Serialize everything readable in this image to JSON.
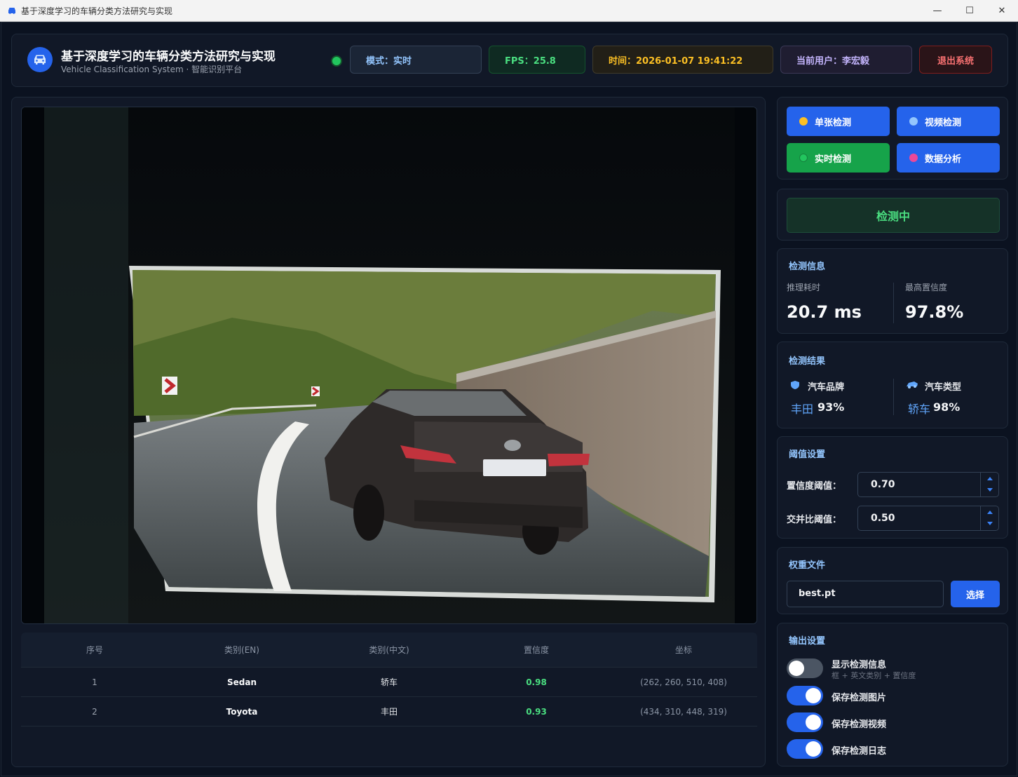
{
  "window": {
    "title": "基于深度学习的车辆分类方法研究与实现",
    "min_glyph": "—",
    "max_glyph": "☐",
    "close_glyph": "✕"
  },
  "header": {
    "title": "基于深度学习的车辆分类方法研究与实现",
    "subtitle": "Vehicle Classification System · 智能识别平台",
    "mode": "模式：实时",
    "fps": "FPS：25.8",
    "time": "时间：2026-01-07 19:41:22",
    "user": "当前用户：李宏毅",
    "exit_label": "退出系统"
  },
  "table": {
    "headers": [
      "序号",
      "类别(EN)",
      "类别(中文)",
      "置信度",
      "坐标"
    ],
    "rows": [
      [
        "1",
        "Sedan",
        "轿车",
        "0.98",
        "(262, 260, 510, 408)"
      ],
      [
        "2",
        "Toyota",
        "丰田",
        "0.93",
        "(434, 310, 448, 319)"
      ]
    ]
  },
  "modes": {
    "single": "单张检测",
    "video": "视频检测",
    "realtime": "实时检测",
    "analysis": "数据分析"
  },
  "status": "检测中",
  "info": {
    "title": "检测信息",
    "latency_label": "推理耗时",
    "latency": "20.7 ms",
    "max_conf_label": "最高置信度",
    "max_conf": "97.8%"
  },
  "result": {
    "title": "检测结果",
    "brand_label": "汽车品牌",
    "brand_name": "丰田",
    "brand_conf": "93%",
    "type_label": "汽车类型",
    "type_name": "轿车",
    "type_conf": "98%"
  },
  "threshold": {
    "title": "阈值设置",
    "conf_label": "置信度阈值：",
    "conf_value": "0.70",
    "iou_label": "交并比阈值：",
    "iou_value": "0.50"
  },
  "weights": {
    "title": "权重文件",
    "file": "best.pt",
    "select_label": "选择"
  },
  "output": {
    "title": "输出设置",
    "show_info": "显示检测信息",
    "show_info_sub": "框 + 英文类别 + 置信度",
    "save_image": "保存检测图片",
    "save_video": "保存检测视频",
    "save_log": "保存检测日志",
    "show_info_on": false,
    "save_image_on": true,
    "save_video_on": true,
    "save_log_on": true
  },
  "colors": {
    "accent": "#2563eb",
    "success": "#22c55e",
    "warning": "#fbbf24",
    "danger": "#f87171"
  }
}
